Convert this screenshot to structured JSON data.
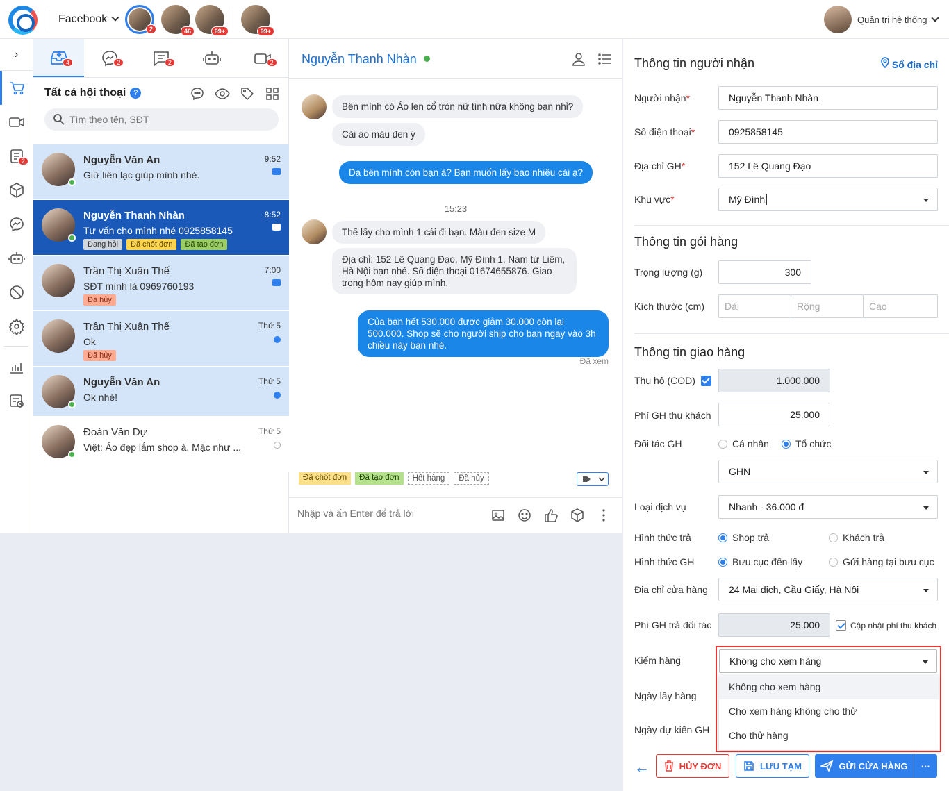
{
  "topbar": {
    "channel": "Facebook",
    "pages": [
      {
        "badge": "2"
      },
      {
        "badge": "46"
      },
      {
        "badge": "99+"
      },
      {
        "badge": "99+"
      }
    ],
    "admin_name": "Quản trị hệ thống"
  },
  "leftnav": {
    "icons": [
      "expand-icon",
      "cart-icon",
      "video-icon",
      "orders-icon",
      "box-icon",
      "messenger-icon",
      "bot-icon",
      "block-icon",
      "settings-icon",
      "stats-icon",
      "report-icon"
    ],
    "orders_badge": "2"
  },
  "tabs": [
    {
      "name": "inbox-tab",
      "badge": "4"
    },
    {
      "name": "messenger-tab",
      "badge": "2"
    },
    {
      "name": "comment-tab",
      "badge": "2"
    },
    {
      "name": "bot-tab",
      "badge": ""
    },
    {
      "name": "livestream-tab",
      "badge": "2"
    }
  ],
  "conversations": {
    "title": "Tất cả hội thoại",
    "help": "?",
    "search_placeholder": "Tìm theo tên, SĐT",
    "items": [
      {
        "name": "Nguyễn Văn An",
        "msg": "Giữ liên lạc giúp mình nhé.",
        "time": "9:52",
        "tags": []
      },
      {
        "name": "Nguyễn Thanh Nhàn",
        "msg": "Tư vấn cho mình nhé 0925858145",
        "time": "8:52",
        "tags": [
          "Đang hỏi",
          "Đã chốt đơn",
          "Đã tạo đơn"
        ]
      },
      {
        "name": "Trần Thị Xuân Thế",
        "msg": "SĐT mình là 0969760193",
        "time": "7:00",
        "tags": [
          "Đã hủy"
        ]
      },
      {
        "name": "Trần Thị Xuân Thế",
        "msg": "Ok",
        "time": "Thứ 5",
        "tags": [
          "Đã hủy"
        ]
      },
      {
        "name": "Nguyễn Văn An",
        "msg": "Ok nhé!",
        "time": "Thứ 5",
        "tags": []
      },
      {
        "name": "Đoàn Văn Dự",
        "msg": "Việt: Áo đẹp lắm shop à. Mặc như ...",
        "time": "Thứ 5",
        "tags": []
      }
    ]
  },
  "chat": {
    "name": "Nguyễn Thanh Nhàn",
    "messages": [
      "Bên mình có Áo len cổ tròn nữ tính nữa không bạn nhỉ?",
      "Cái áo màu đen ý",
      "Dạ bên mình còn bạn à? Bạn muốn lấy bao nhiêu cái ạ?",
      "Thế lấy cho mình 1 cái đi bạn. Màu đen size M",
      "Địa chỉ: 152 Lê Quang Đạo, Mỹ Đình 1, Nam từ Liêm, Hà Nội bạn nhé. Số điện thoại 01674655876. Giao trong hôm nay giúp mình.",
      "Của bạn hết 530.000 được giảm 30.000 còn lại 500.000. Shop sẽ cho người ship cho bạn ngay vào 3h chiều này bạn nhé."
    ],
    "time_sep": "15:23",
    "seen": "Đã xem",
    "quick_tags": [
      "Đã chốt đơn",
      "Đã tạo đơn",
      "Hết hàng",
      "Đã hủy"
    ],
    "composer_placeholder": "Nhập và ấn Enter để trả lời"
  },
  "recipient": {
    "title": "Thông tin người nhận",
    "address_book": "Sổ địa chỉ",
    "name_label": "Người nhận",
    "name": "Nguyễn Thanh Nhàn",
    "phone_label": "Số điện thoại",
    "phone": "0925858145",
    "addr_label": "Địa chỉ GH",
    "addr": "152 Lê Quang Đạo",
    "area_label": "Khu vực",
    "area": "Mỹ Đình",
    "req": "*"
  },
  "package": {
    "title": "Thông tin gói hàng",
    "weight_label": "Trọng lượng (g)",
    "weight": "300",
    "size_label": "Kích thước (cm)",
    "length_ph": "Dài",
    "width_ph": "Rộng",
    "height_ph": "Cao"
  },
  "delivery": {
    "title": "Thông tin giao hàng",
    "cod_label": "Thu hộ (COD)",
    "cod": "1.000.000",
    "fee_label": "Phí GH thu khách",
    "fee": "25.000",
    "partner_label": "Đối tác GH",
    "partner_individual": "Cá nhân",
    "partner_org": "Tổ chức",
    "carrier": "GHN",
    "service_label": "Loại dịch vụ",
    "service": "Nhanh - 36.000 đ",
    "pay_label": "Hình thức trả",
    "pay_shop": "Shop trả",
    "pay_customer": "Khách trả",
    "ship_label": "Hình thức GH",
    "ship_pickup": "Bưu cục đến lấy",
    "ship_dropoff": "Gửi hàng tại bưu cục",
    "store_label": "Địa chỉ cửa hàng",
    "store": "24 Mai dịch, Cầu Giấy, Hà Nội",
    "partner_fee_label": "Phí GH trả đối tác",
    "partner_fee": "25.000",
    "update_fee": "Cập nhật phí thu khách",
    "inspect_label": "Kiểm hàng",
    "inspect": "Không cho xem hàng",
    "inspect_options": [
      "Không cho xem hàng",
      "Cho xem hàng không cho thử",
      "Cho thử hàng"
    ],
    "pickup_date_label": "Ngày lấy hàng",
    "eta_label": "Ngày dự kiến GH"
  },
  "actions": {
    "cancel": "HỦY ĐƠN",
    "save": "LƯU TẠM",
    "send": "GỬI CỬA HÀNG",
    "more": "···"
  }
}
